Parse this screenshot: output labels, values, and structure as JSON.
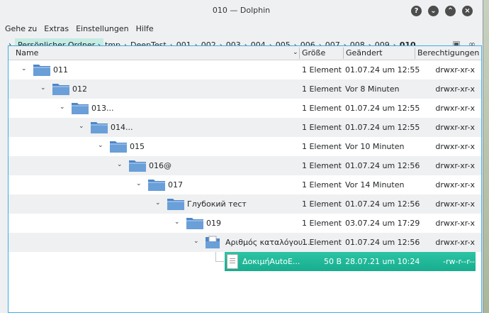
{
  "window": {
    "title": "010 — Dolphin"
  },
  "menubar": [
    {
      "label": "Gehe zu"
    },
    {
      "label": "Extras"
    },
    {
      "label": "Einstellungen"
    },
    {
      "label": "Hilfe"
    }
  ],
  "breadcrumb": {
    "home": "Persönlicher Ordner",
    "parts": [
      "tmp",
      "DeepTest",
      "001",
      "002",
      "003",
      "004",
      "005",
      "006",
      "007",
      "008",
      "009"
    ],
    "current": "010"
  },
  "columns": {
    "name": "Name",
    "size": "Größe",
    "modified": "Geändert",
    "perms": "Berechtigungen"
  },
  "rows": [
    {
      "name": "011",
      "size": "1 Element",
      "modified": "01.07.24 um 12:55",
      "perms": "drwxr-xr-x"
    },
    {
      "name": "012",
      "size": "1 Element",
      "modified": "Vor 8 Minuten",
      "perms": "drwxr-xr-x"
    },
    {
      "name": "013...",
      "size": "1 Element",
      "modified": "01.07.24 um 12:55",
      "perms": "drwxr-xr-x"
    },
    {
      "name": "014...",
      "size": "1 Element",
      "modified": "01.07.24 um 12:55",
      "perms": "drwxr-xr-x"
    },
    {
      "name": "015",
      "size": "1 Element",
      "modified": "Vor 10 Minuten",
      "perms": "drwxr-xr-x"
    },
    {
      "name": "016@",
      "size": "1 Element",
      "modified": "01.07.24 um 12:56",
      "perms": "drwxr-xr-x"
    },
    {
      "name": "017",
      "size": "1 Element",
      "modified": "Vor 14 Minuten",
      "perms": "drwxr-xr-x"
    },
    {
      "name": "Глубокий тест",
      "size": "1 Element",
      "modified": "01.07.24 um 12:56",
      "perms": "drwxr-xr-x"
    },
    {
      "name": "019",
      "size": "1 Element",
      "modified": "03.07.24 um 17:29",
      "perms": "drwxr-xr-x"
    },
    {
      "name": "Αριθμός καταλόγου ...",
      "size": "1 Element",
      "modified": "01.07.24 um 12:56",
      "perms": "drwxr-xr-x"
    }
  ],
  "selected_file": {
    "name": "ΔοκιμήAutoE...",
    "size": "50 B",
    "modified": "28.07.21 um 10:24",
    "perms": "-rw-r--r--"
  },
  "colors": {
    "accent": "#1abc9c",
    "folder": "#6a9fd8",
    "focus": "#3daee9"
  }
}
